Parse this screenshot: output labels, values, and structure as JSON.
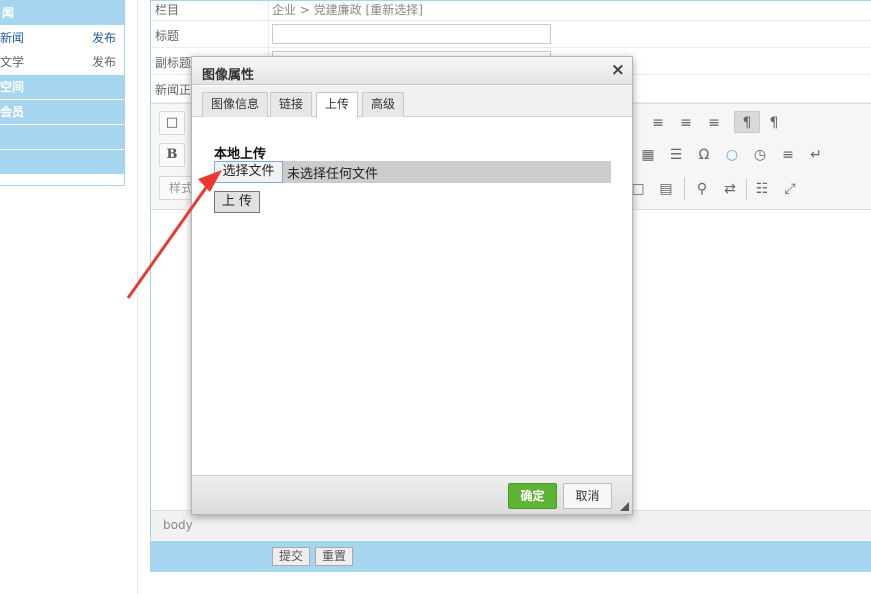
{
  "sidebar": {
    "header": "闻",
    "rows": [
      {
        "label": "新闻",
        "action": "发布"
      },
      {
        "label": "文学",
        "action": "发布"
      }
    ],
    "categories": [
      "空间",
      "会员",
      "",
      ""
    ]
  },
  "form": {
    "rows": [
      {
        "label": "栏目",
        "path": "企业 > 党建廉政",
        "reselect": "[重新选择]"
      },
      {
        "label": "标题"
      },
      {
        "label": "副标题"
      },
      {
        "label": "新闻正"
      }
    ]
  },
  "editor": {
    "toolbar_row1": [
      "¶",
      "¶"
    ],
    "toolbar_row2": [
      "B",
      "Ω"
    ],
    "toolbar_row3": [
      "样式"
    ],
    "status_path": "body"
  },
  "actions": {
    "submit": "提交",
    "reset": "重置"
  },
  "dialog": {
    "title": "图像属性",
    "close": "×",
    "tabs": [
      "图像信息",
      "链接",
      "上传",
      "高级"
    ],
    "active_tab": "上传",
    "section_title": "本地上传",
    "choose_file": "选择文件",
    "no_file": "未选择任何文件",
    "upload": "上 传",
    "ok": "确定",
    "cancel": "取消"
  },
  "colors": {
    "sidebar_blue": "#a6d6ef",
    "ok_green": "#5fb334",
    "arrow_red": "#e83a2e",
    "link_blue": "#215fa3"
  }
}
